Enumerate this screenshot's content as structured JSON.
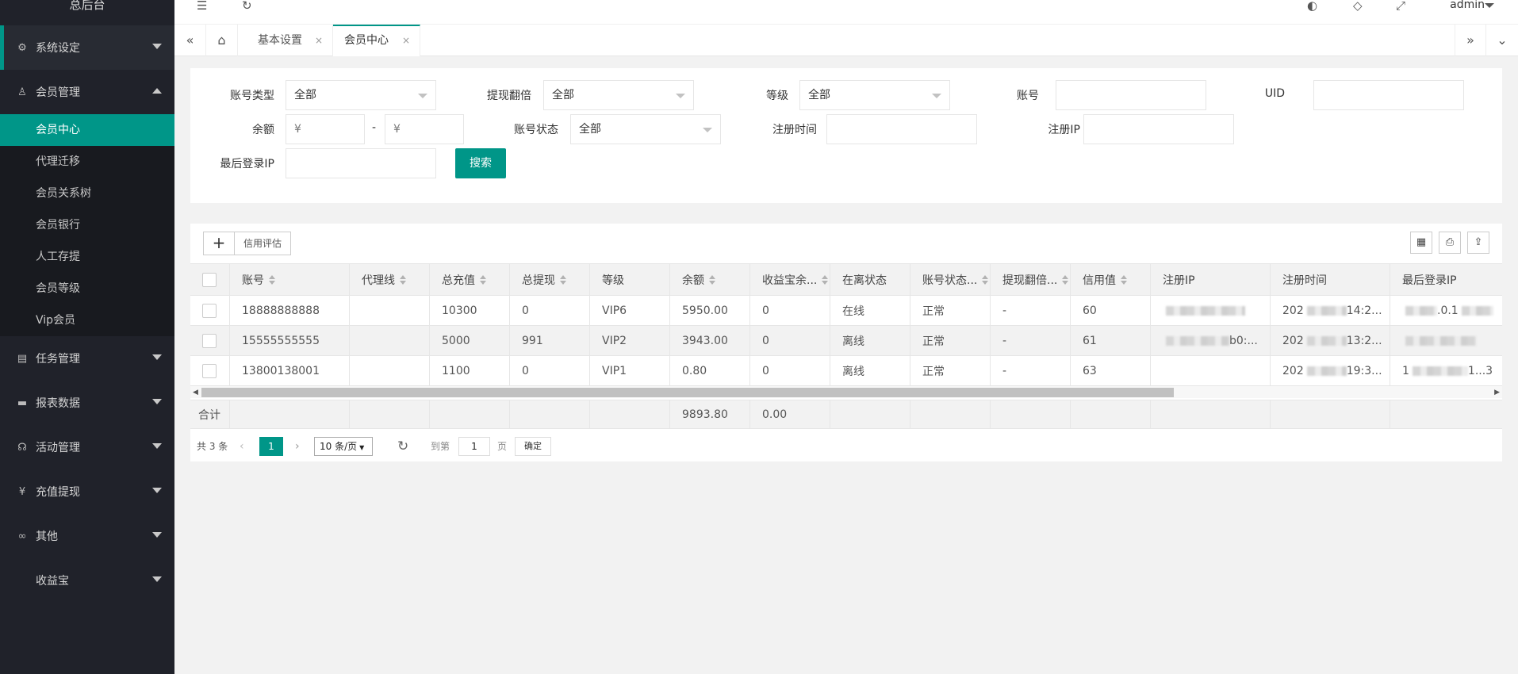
{
  "sidebar": {
    "logo": "总后台",
    "groups": [
      {
        "label": "系统设定",
        "icon": "gear-icon",
        "glyph": "⚙"
      },
      {
        "label": "会员管理",
        "icon": "user-icon",
        "glyph": "♙"
      },
      {
        "label": "任务管理",
        "icon": "document-icon",
        "glyph": "▤"
      },
      {
        "label": "报表数据",
        "icon": "chat-icon",
        "glyph": "▬"
      },
      {
        "label": "活动管理",
        "icon": "headset-icon",
        "glyph": "☊"
      },
      {
        "label": "充值提现",
        "icon": "yen-icon",
        "glyph": "¥"
      },
      {
        "label": "其他",
        "icon": "infinity-icon",
        "glyph": "∞"
      },
      {
        "label": "收益宝",
        "icon": "",
        "glyph": ""
      }
    ],
    "submenu": [
      "会员中心",
      "代理迁移",
      "会员关系树",
      "会员银行",
      "人工存提",
      "会员等级",
      "Vip会员"
    ]
  },
  "topbar": {
    "user": "admin",
    "icons": [
      "menu-fold-icon",
      "refresh-icon",
      "theme-icon",
      "tag-icon",
      "fullscreen-icon"
    ]
  },
  "tabs": {
    "items": [
      {
        "label": "基本设置",
        "close": "×"
      },
      {
        "label": "会员中心",
        "close": "×"
      }
    ]
  },
  "filter": {
    "account_type": {
      "label": "账号类型",
      "value": "全部"
    },
    "withdraw_multiple": {
      "label": "提现翻倍",
      "value": "全部"
    },
    "level": {
      "label": "等级",
      "value": "全部"
    },
    "account": {
      "label": "账号",
      "value": ""
    },
    "uid": {
      "label": "UID",
      "value": ""
    },
    "balance": {
      "label": "余额",
      "min_placeholder": "¥",
      "max_placeholder": "¥",
      "dash": "-"
    },
    "account_status": {
      "label": "账号状态",
      "value": "全部"
    },
    "register_time": {
      "label": "注册时间",
      "value": ""
    },
    "register_ip": {
      "label": "注册IP",
      "value": ""
    },
    "last_login_ip": {
      "label": "最后登录IP",
      "value": ""
    },
    "search_label": "搜索"
  },
  "toolbar": {
    "add_label": "+",
    "credit_label": "信用评估"
  },
  "table": {
    "columns": [
      "账号",
      "代理线",
      "总充值",
      "总提现",
      "等级",
      "余额",
      "收益宝余...",
      "在离状态",
      "账号状态...",
      "提现翻倍...",
      "信用值",
      "注册IP",
      "注册时间",
      "最后登录IP"
    ],
    "rows": [
      {
        "account": "18888888888",
        "agent": "",
        "recharge": "10300",
        "withdraw": "0",
        "level": "VIP6",
        "balance": "5950.00",
        "yield": "0",
        "online": "在线",
        "status": "正常",
        "multiple": "-",
        "credit": "60",
        "reg_ip": "",
        "reg_time": "202",
        "reg_time_tail": "14:2...",
        "last_ip": "",
        "last_ip_tail": ".0.1"
      },
      {
        "account": "15555555555",
        "agent": "",
        "recharge": "5000",
        "withdraw": "991",
        "level": "VIP2",
        "balance": "3943.00",
        "yield": "0",
        "online": "离线",
        "status": "正常",
        "multiple": "-",
        "credit": "61",
        "reg_ip": "b0:...",
        "reg_time": "202",
        "reg_time_tail": "13:2...",
        "last_ip": "",
        "last_ip_tail": ""
      },
      {
        "account": "13800138001",
        "agent": "",
        "recharge": "1100",
        "withdraw": "0",
        "level": "VIP1",
        "balance": "0.80",
        "yield": "0",
        "online": "离线",
        "status": "正常",
        "multiple": "-",
        "credit": "63",
        "reg_ip": "",
        "reg_time": "202",
        "reg_time_tail": "19:3...",
        "last_ip": "1",
        "last_ip_tail": "1...3"
      }
    ],
    "total": {
      "label": "合计",
      "balance": "9893.80",
      "yield": "0.00"
    }
  },
  "pager": {
    "count_text": "共 3 条",
    "current_page": "1",
    "page_size": "10 条/页",
    "goto_label": "到第",
    "goto_value": "1",
    "page_unit": "页",
    "confirm_label": "确定"
  }
}
